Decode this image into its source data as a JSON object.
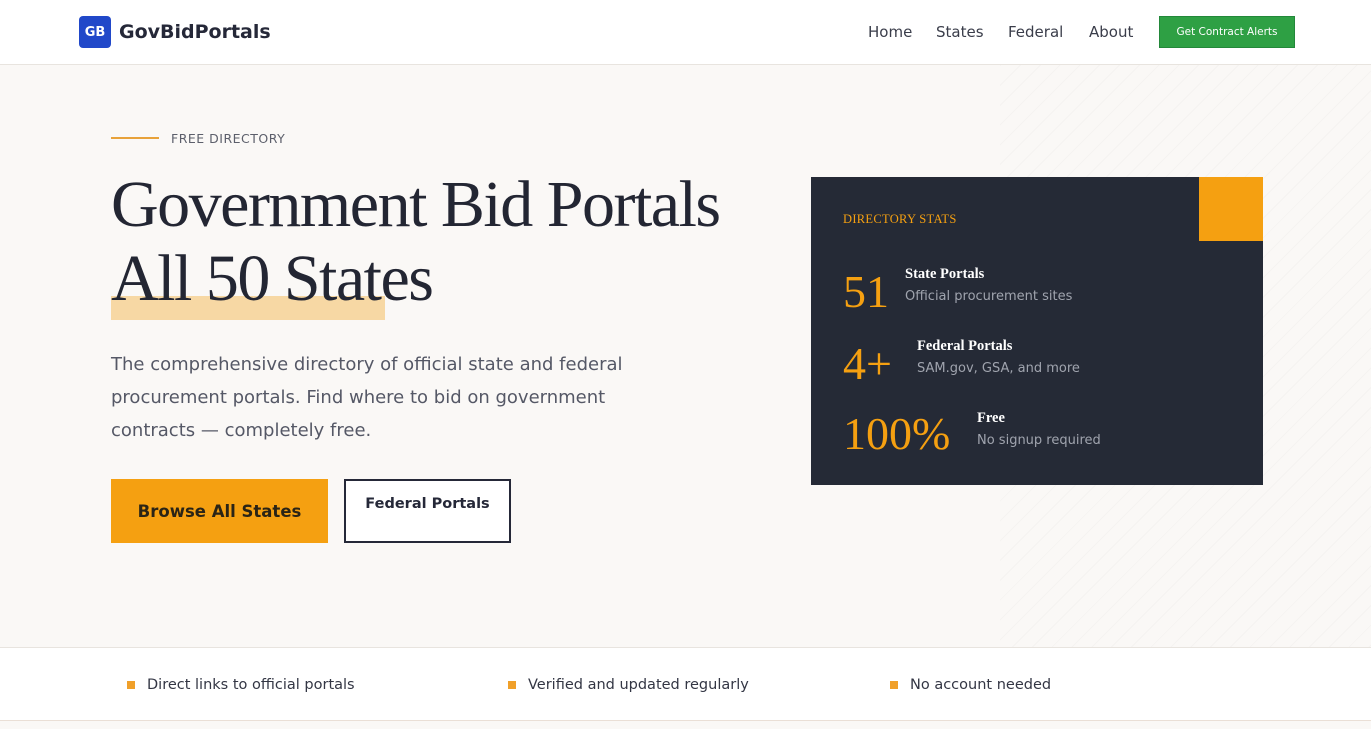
{
  "nav": {
    "logo_mark": "GB",
    "brand": "GovBidPortals",
    "links": [
      "Home",
      "States",
      "Federal",
      "About"
    ],
    "cta": "Get Contract Alerts"
  },
  "hero": {
    "eyebrow": "FREE DIRECTORY",
    "title_line1": "Government Bid Portals",
    "title_line2": "All 50 States",
    "description": "The comprehensive directory of official state and federal procurement portals. Find where to bid on government contracts — completely free.",
    "primary_button": "Browse All States",
    "secondary_button": "Federal Portals"
  },
  "stats": {
    "label": "DIRECTORY STATS",
    "items": [
      {
        "number": "51",
        "title": "State Portals",
        "subtitle": "Official procurement sites"
      },
      {
        "number": "4+",
        "title": "Federal Portals",
        "subtitle": "SAM.gov, GSA, and more"
      },
      {
        "number": "100%",
        "title": "Free",
        "subtitle": "No signup required"
      }
    ]
  },
  "features": [
    "Direct links to official portals",
    "Verified and updated regularly",
    "No account needed"
  ],
  "colors": {
    "accent": "#f5a011",
    "brand_blue": "#2148c9",
    "cta_green": "#2ea044",
    "card_dark": "#252a36"
  }
}
